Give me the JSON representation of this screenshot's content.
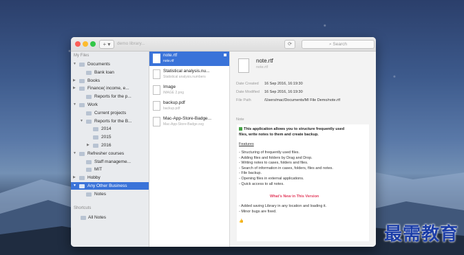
{
  "window": {
    "title_path": "demo library...",
    "add_button": "+ ▾",
    "search_placeholder": "Search"
  },
  "sidebar": {
    "my_files_heading": "My Files",
    "shortcuts_heading": "Shortcuts",
    "items": [
      {
        "label": "Documents",
        "depth": 0,
        "arrow": "▼"
      },
      {
        "label": "Bank loan",
        "depth": 1,
        "arrow": ""
      },
      {
        "label": "Books",
        "depth": 0,
        "arrow": "▶"
      },
      {
        "label": "Finance( income, e...",
        "depth": 0,
        "arrow": "▶"
      },
      {
        "label": "Reports for the p...",
        "depth": 1,
        "arrow": ""
      },
      {
        "label": "Work",
        "depth": 0,
        "arrow": "▼"
      },
      {
        "label": "Current projects",
        "depth": 1,
        "arrow": ""
      },
      {
        "label": "Reports for the B...",
        "depth": 1,
        "arrow": "▼"
      },
      {
        "label": "2014",
        "depth": 2,
        "arrow": ""
      },
      {
        "label": "2015",
        "depth": 2,
        "arrow": ""
      },
      {
        "label": "2016",
        "depth": 2,
        "arrow": "▶"
      },
      {
        "label": "Refresher courses",
        "depth": 0,
        "arrow": "▼"
      },
      {
        "label": "Staff manageme...",
        "depth": 1,
        "arrow": ""
      },
      {
        "label": "MIT",
        "depth": 1,
        "arrow": ""
      },
      {
        "label": "Hobby",
        "depth": 0,
        "arrow": "▶"
      },
      {
        "label": "Any Other Business",
        "depth": 0,
        "arrow": "▼",
        "selected": true
      },
      {
        "label": "Notes",
        "depth": 1,
        "arrow": ""
      }
    ],
    "shortcuts": [
      {
        "label": "All Notes"
      }
    ]
  },
  "files": [
    {
      "name": "note.rtf",
      "sub": "note.rtf",
      "selected": true
    },
    {
      "name": "Statistical analysis.nu...",
      "sub": "Statistical analysis.numbers"
    },
    {
      "name": "Image",
      "sub": "IMAGE 2.png"
    },
    {
      "name": "backup.pdf",
      "sub": "backup.pdf"
    },
    {
      "name": "Mac-App-Store-Badge...",
      "sub": "Mac-App-Store-Badge.svg"
    }
  ],
  "detail": {
    "title": "note.rtf",
    "subtitle": "note.rtf",
    "date_created_label": "Date Created",
    "date_created": "16 Sep 2016, 16:19:30",
    "date_modified_label": "Date Modified",
    "date_modified": "16 Sep 2016, 16:19:30",
    "file_path_label": "File Path",
    "file_path": "/Users/mac/Documents/MI File Demo/note.rtf",
    "note_label": "Note",
    "note": {
      "intro_1": "This application allows you to structure frequently used",
      "intro_2": "files, write notes to them and create backup.",
      "features_heading": "Features",
      "features": [
        "- Structuring of frequently used files.",
        "- Adding files and folders by Drag and Drop.",
        "- Writing notes to cases, folders and files.",
        "- Search of information in cases, folders, files and notes.",
        "- File backup.",
        "- Opening files in external applications.",
        "- Quick access to all notes."
      ],
      "whats_new": "What's New in This Version",
      "changes": [
        "- Added saving Library in any location and loading it.",
        "- Minor bugs are fixed."
      ],
      "thumb": "👍"
    }
  },
  "watermark": "最需教育"
}
